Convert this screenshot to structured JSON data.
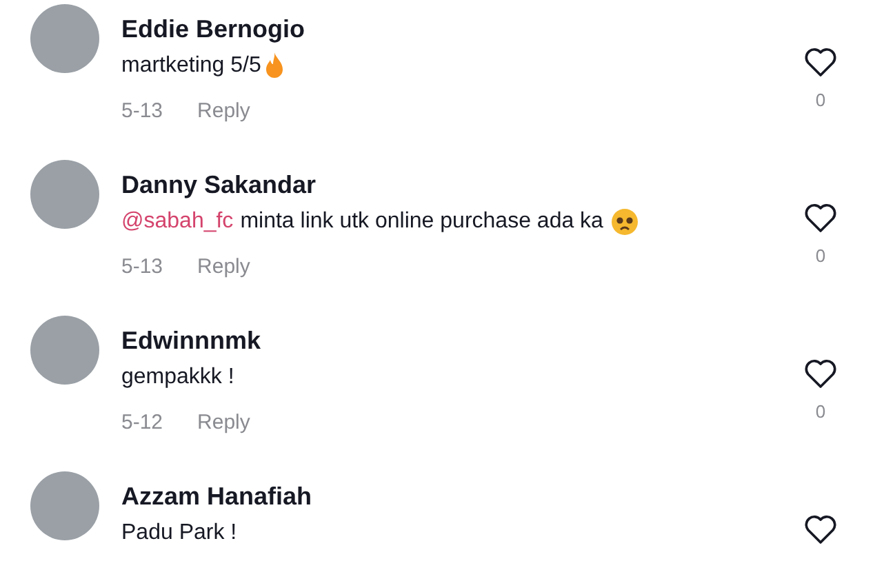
{
  "comments": [
    {
      "kind": "fire",
      "user": "Eddie Bernogio",
      "text": "martketing 5/5",
      "date": "5-13",
      "reply": "Reply",
      "likes": "0"
    },
    {
      "kind": "sad",
      "user": "Danny Sakandar",
      "mention": "@sabah_fc",
      "text": "minta link utk online purchase ada ka",
      "date": "5-13",
      "reply": "Reply",
      "likes": "0"
    },
    {
      "kind": "plain",
      "user": "Edwinnnmk",
      "text": "gempakkk !",
      "date": "5-12",
      "reply": "Reply",
      "likes": "0"
    },
    {
      "kind": "plain",
      "user": "Azzam Hanafiah",
      "text": "Padu Park !"
    }
  ]
}
